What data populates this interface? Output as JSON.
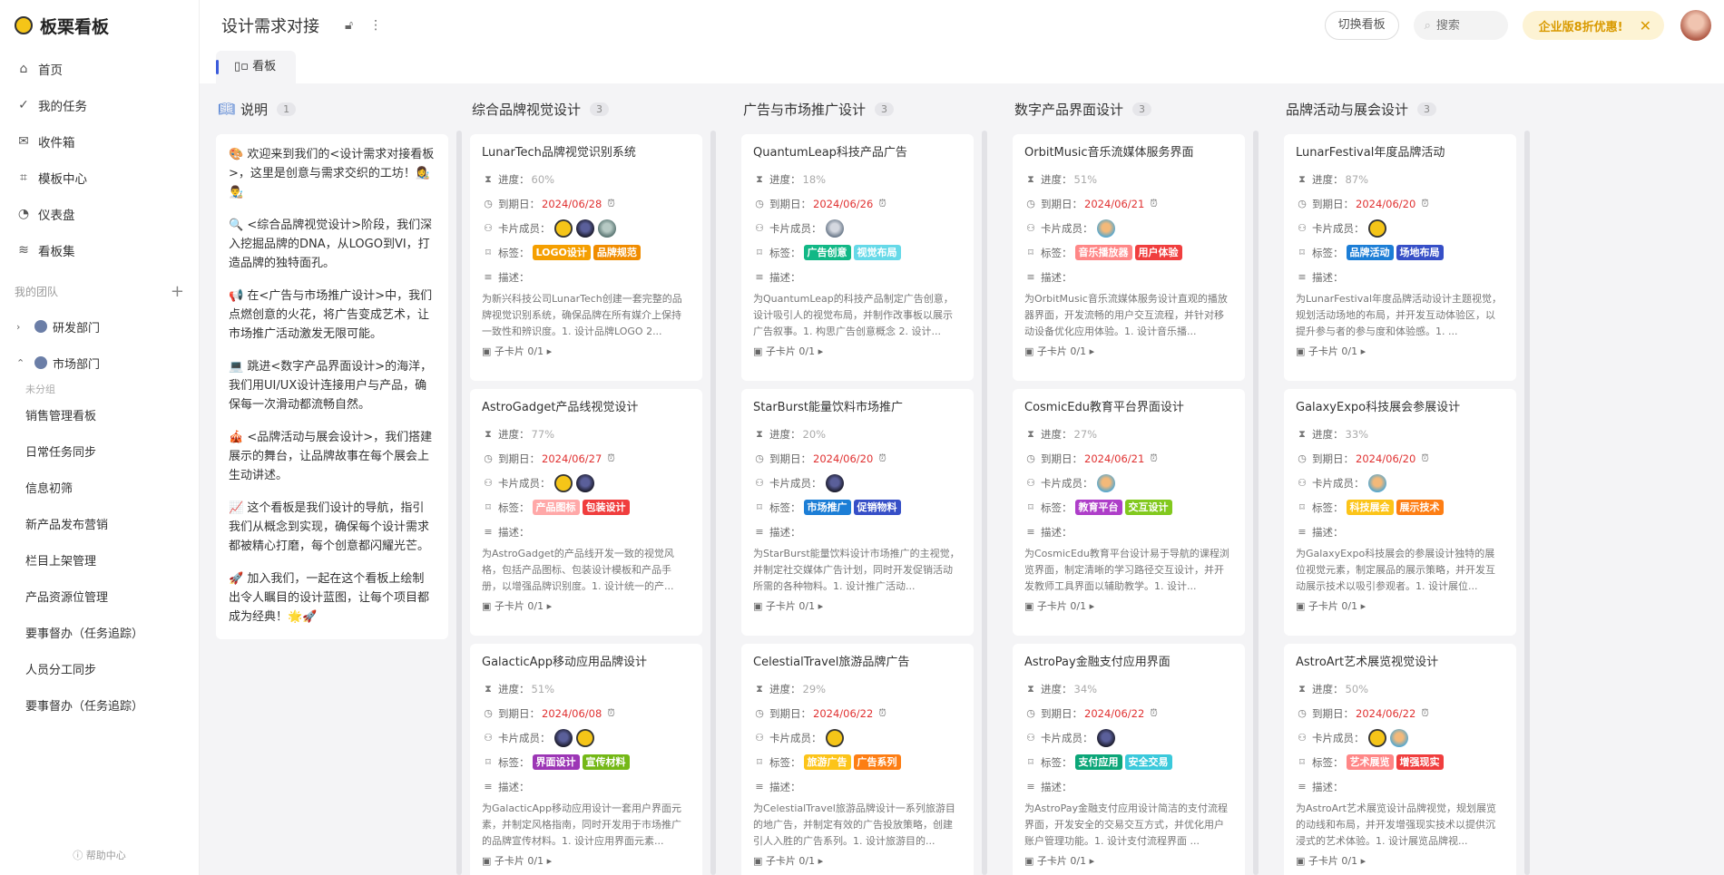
{
  "app": {
    "name": "板栗看板"
  },
  "nav": [
    {
      "label": "首页",
      "icon": "home-icon"
    },
    {
      "label": "我的任务",
      "icon": "check-circle-icon"
    },
    {
      "label": "收件箱",
      "icon": "mail-icon"
    },
    {
      "label": "模板中心",
      "icon": "template-icon"
    },
    {
      "label": "仪表盘",
      "icon": "dashboard-icon"
    },
    {
      "label": "看板集",
      "icon": "layers-icon"
    }
  ],
  "team": {
    "heading": "我的团队",
    "depts": [
      {
        "label": "研发部门"
      },
      {
        "label": "市场部门"
      }
    ],
    "ungrouped": "未分组",
    "boards": [
      "销售管理看板",
      "日常任务同步",
      "信息初筛",
      "新产品发布营销",
      "栏目上架管理",
      "产品资源位管理",
      "要事督办（任务追踪）",
      "人员分工同步",
      "要事督办（任务追踪）"
    ]
  },
  "help": "帮助中心",
  "header": {
    "title": "设计需求对接",
    "switch": "切换看板",
    "search_placeholder": "搜索",
    "promo": "企业版8折优惠!"
  },
  "tab": {
    "label": "看板"
  },
  "field_labels": {
    "progress": "进度：",
    "due": "到期日：",
    "members": "卡片成员：",
    "tags": "标签：",
    "desc": "描述："
  },
  "intro": {
    "title": "说明",
    "count": "1",
    "paragraphs": [
      "🎨 欢迎来到我们的<设计需求对接看板>，这里是创意与需求交织的工坊！👩‍🎨👨‍🎨",
      "🔍 <综合品牌视觉设计>阶段，我们深入挖掘品牌的DNA，从LOGO到VI，打造品牌的独特面孔。",
      "📢 在<广告与市场推广设计>中，我们点燃创意的火花，将广告变成艺术，让市场推广活动激发无限可能。",
      "💻 跳进<数字产品界面设计>的海洋，我们用UI/UX设计连接用户与产品，确保每一次滑动都流畅自然。",
      "🎪 <品牌活动与展会设计>，我们搭建展示的舞台，让品牌故事在每个展会上生动讲述。",
      "📈 这个看板是我们设计的导航，指引我们从概念到实现，确保每个设计需求都被精心打磨，每个创意都闪耀光芒。",
      "🚀 加入我们，一起在这个看板上绘制出令人瞩目的设计蓝图，让每个项目都成为经典！🌟🚀"
    ]
  },
  "columns": [
    {
      "title": "综合品牌视觉设计",
      "count": "3",
      "cards": [
        {
          "title": "LunarTech品牌视觉识别系统",
          "progress": "60%",
          "due": "2024/06/28",
          "members": [
            "yellow",
            "dark",
            "green"
          ],
          "tags": [
            {
              "label": "LOGO设计",
              "color": "#f59f00"
            },
            {
              "label": "品牌规范",
              "color": "#f08c00"
            }
          ],
          "desc": "为新兴科技公司LunarTech创建一套完整的品牌视觉识别系统，确保品牌在所有媒介上保持一致性和辨识度。1. 设计品牌LOGO 2...",
          "sub": "子卡片 0/1"
        },
        {
          "title": "AstroGadget产品线视觉设计",
          "progress": "77%",
          "due": "2024/06/27",
          "members": [
            "yellow",
            "dark"
          ],
          "tags": [
            {
              "label": "产品图标",
              "color": "#ffa8a8"
            },
            {
              "label": "包装设计",
              "color": "#f03e3e"
            }
          ],
          "desc": "为AstroGadget的产品线开发一致的视觉风格，包括产品图标、包装设计模板和产品手册，以增强品牌识别度。1. 设计统一的产...",
          "sub": "子卡片 0/1"
        },
        {
          "title": "GalacticApp移动应用品牌设计",
          "progress": "51%",
          "due": "2024/06/08",
          "members": [
            "dark",
            "yellow"
          ],
          "tags": [
            {
              "label": "界面设计",
              "color": "#9c36b5"
            },
            {
              "label": "宣传材料",
              "color": "#74b816"
            }
          ],
          "desc": "为GalacticApp移动应用设计一套用户界面元素，并制定风格指南，同时开发用于市场推广的品牌宣传材料。1. 设计应用界面元素...",
          "sub": "子卡片 0/1"
        }
      ]
    },
    {
      "title": "广告与市场推广设计",
      "count": "3",
      "cards": [
        {
          "title": "QuantumLeap科技产品广告",
          "progress": "18%",
          "due": "2024/06/26",
          "members": [
            "gray"
          ],
          "tags": [
            {
              "label": "广告创意",
              "color": "#12b886"
            },
            {
              "label": "视觉布局",
              "color": "#66d9e8"
            }
          ],
          "desc": "为QuantumLeap的科技产品制定广告创意，设计吸引人的视觉布局，并制作改事板以展示广告叙事。1. 构思广告创意概念 2. 设计...",
          "sub": "子卡片 0/1"
        },
        {
          "title": "StarBurst能量饮料市场推广",
          "progress": "20%",
          "due": "2024/06/20",
          "members": [
            "dark"
          ],
          "tags": [
            {
              "label": "市场推广",
              "color": "#1c7ed6"
            },
            {
              "label": "促销物料",
              "color": "#364fc7"
            }
          ],
          "desc": "为StarBurst能量饮料设计市场推广的主视觉，并制定社交媒体广告计划，同时开发促销活动所需的各种物料。1. 设计推广活动...",
          "sub": "子卡片 0/1"
        },
        {
          "title": "CelestialTravel旅游品牌广告",
          "progress": "29%",
          "due": "2024/06/22",
          "members": [
            "yellow"
          ],
          "tags": [
            {
              "label": "旅游广告",
              "color": "#fcc419"
            },
            {
              "label": "广告系列",
              "color": "#fd7e14"
            }
          ],
          "desc": "为CelestialTravel旅游品牌设计一系列旅游目的地广告，并制定有效的广告投放策略，创建引人入胜的广告系列。1. 设计旅游目的...",
          "sub": "子卡片 0/1"
        }
      ]
    },
    {
      "title": "数字产品界面设计",
      "count": "3",
      "cards": [
        {
          "title": "OrbitMusic音乐流媒体服务界面",
          "progress": "51%",
          "due": "2024/06/21",
          "members": [
            "sky"
          ],
          "tags": [
            {
              "label": "音乐播放器",
              "color": "#ff8787"
            },
            {
              "label": "用户体验",
              "color": "#f03e3e"
            }
          ],
          "desc": "为OrbitMusic音乐流媒体服务设计直观的播放器界面，开发流畅的用户交互流程，并针对移动设备优化应用体验。1. 设计音乐播...",
          "sub": "子卡片 0/1"
        },
        {
          "title": "CosmicEdu教育平台界面设计",
          "progress": "27%",
          "due": "2024/06/21",
          "members": [
            "sky"
          ],
          "tags": [
            {
              "label": "教育平台",
              "color": "#ae3ec9"
            },
            {
              "label": "交互设计",
              "color": "#82c91e"
            }
          ],
          "desc": "为CosmicEdu教育平台设计易于导航的课程浏览界面，制定清晰的学习路径交互设计，并开发教师工具界面以辅助教学。1. 设计...",
          "sub": "子卡片 0/1"
        },
        {
          "title": "AstroPay金融支付应用界面",
          "progress": "34%",
          "due": "2024/06/22",
          "members": [
            "dark"
          ],
          "tags": [
            {
              "label": "支付应用",
              "color": "#0ca678"
            },
            {
              "label": "安全交易",
              "color": "#3bc9db"
            }
          ],
          "desc": "为AstroPay金融支付应用设计简洁的支付流程界面，开发安全的交易交互方式，并优化用户账户管理功能。1. 设计支付流程界面 ...",
          "sub": "子卡片 0/1"
        }
      ]
    },
    {
      "title": "品牌活动与展会设计",
      "count": "3",
      "cards": [
        {
          "title": "LunarFestival年度品牌活动",
          "progress": "87%",
          "due": "2024/06/20",
          "members": [
            "yellow"
          ],
          "tags": [
            {
              "label": "品牌活动",
              "color": "#1c7ed6"
            },
            {
              "label": "场地布局",
              "color": "#364fc7"
            }
          ],
          "desc": "为LunarFestival年度品牌活动设计主题视觉，规划活动场地的布局，并开发互动体验区，以提升参与者的参与度和体验感。1. ...",
          "sub": "子卡片 0/1"
        },
        {
          "title": "GalaxyExpo科技展会参展设计",
          "progress": "33%",
          "due": "2024/06/20",
          "members": [
            "sky"
          ],
          "tags": [
            {
              "label": "科技展会",
              "color": "#fcc419"
            },
            {
              "label": "展示技术",
              "color": "#fd7e14"
            }
          ],
          "desc": "为GalaxyExpo科技展会的参展设计独特的展位视觉元素，制定展品的展示策略，并开发互动展示技术以吸引参观者。1. 设计展位...",
          "sub": "子卡片 0/1"
        },
        {
          "title": "AstroArt艺术展览视觉设计",
          "progress": "50%",
          "due": "2024/06/22",
          "members": [
            "yellow",
            "sky"
          ],
          "tags": [
            {
              "label": "艺术展览",
              "color": "#ff8787"
            },
            {
              "label": "增强现实",
              "color": "#f03e3e"
            }
          ],
          "desc": "为AstroArt艺术展览设计品牌视觉，规划展览的动线和布局，并开发增强现实技术以提供沉浸式的艺术体验。1. 设计展览品牌视...",
          "sub": "子卡片 0/1"
        }
      ]
    }
  ]
}
